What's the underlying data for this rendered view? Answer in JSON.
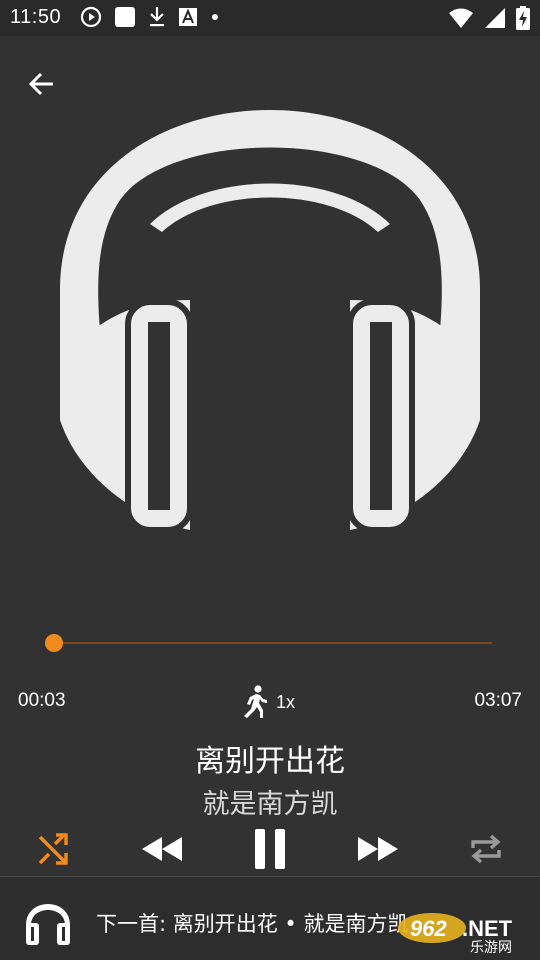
{
  "status_bar": {
    "time": "11:50",
    "icons_left": [
      "play-circle-icon",
      "white-square-icon",
      "download-icon",
      "font-a-icon",
      "dot-icon"
    ],
    "icons_right": [
      "wifi-icon",
      "cellular-signal-icon",
      "battery-charging-icon"
    ]
  },
  "player": {
    "artwork_icon": "headphones-icon",
    "progress": 0.0,
    "elapsed": "00:03",
    "total": "03:07",
    "speed": "1x",
    "title": "离别开出花",
    "artist": "就是南方凯",
    "colors": {
      "accent": "#f28a1e",
      "background": "#323232"
    }
  },
  "controls": {
    "shuffle": "shuffle-icon",
    "previous": "rewind-icon",
    "play_pause": "pause-icon",
    "next": "fast-forward-icon",
    "repeat": "repeat-icon"
  },
  "next_up": {
    "label": "下一首: 离别开出花 • 就是南方凯"
  },
  "watermark": {
    "brand": "962.NET",
    "subtitle": "乐游网"
  }
}
